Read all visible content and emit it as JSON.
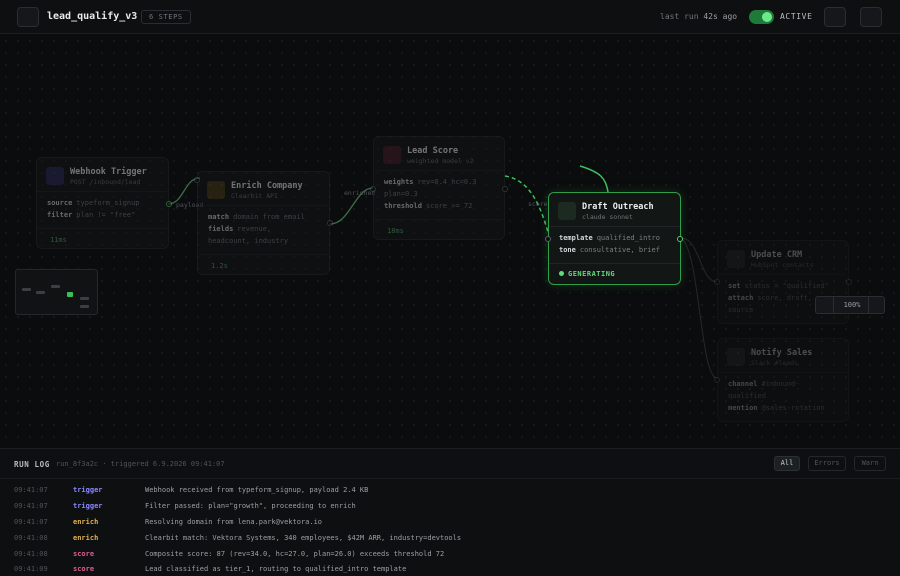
{
  "header": {
    "title": "lead_qualify_v3",
    "steps_badge": "6 STEPS",
    "last_run_prefix": "last run",
    "last_run_value": "42s ago",
    "status": "ACTIVE"
  },
  "nodes": {
    "webhook": {
      "title": "Webhook Trigger",
      "subtitle": "POST /inbound/lead",
      "fields": [
        {
          "key": "source",
          "value": "typeform_signup"
        },
        {
          "key": "filter",
          "value": "plan != \"free\""
        }
      ],
      "timing": "11ms"
    },
    "enrich": {
      "title": "Enrich Company",
      "subtitle": "Clearbit API",
      "fields": [
        {
          "key": "match",
          "value": "domain from email"
        },
        {
          "key": "fields",
          "value": "revenue,"
        },
        {
          "key": "",
          "value": "headcount, industry"
        }
      ],
      "timing": "1.2s"
    },
    "score": {
      "title": "Lead Score",
      "subtitle": "weighted model v2",
      "fields": [
        {
          "key": "weights",
          "value": "rev=0.4 hc=0.3"
        },
        {
          "key": "",
          "value": "plan=0.3"
        },
        {
          "key": "threshold",
          "value": "score >= 72"
        }
      ],
      "timing": "18ms"
    },
    "draft": {
      "title": "Draft Outreach",
      "subtitle": "claude sonnet",
      "fields": [
        {
          "key": "template",
          "value": "qualified_intro"
        },
        {
          "key": "tone",
          "value": "consultative, brief"
        }
      ],
      "status": "GENERATING"
    },
    "crm": {
      "title": "Update CRM",
      "subtitle": "HubSpot contacts",
      "fields": [
        {
          "key": "set",
          "value": "status = \"qualified\""
        },
        {
          "key": "attach",
          "value": "score, draft,"
        },
        {
          "key": "",
          "value": "source"
        }
      ]
    },
    "notify": {
      "title": "Notify Sales",
      "subtitle": "Slack #leads",
      "fields": [
        {
          "key": "channel",
          "value": "#inbound-"
        },
        {
          "key": "",
          "value": "qualified"
        },
        {
          "key": "mention",
          "value": "@sales-rotation"
        }
      ]
    }
  },
  "edge_labels": {
    "webhook_enrich": "payload",
    "enrich_score": "enriched",
    "score_draft": "score"
  },
  "zoom_level": "100%",
  "run_log": {
    "title": "RUN LOG",
    "meta": "run_8f3a2c · triggered 6.9.2026 09:41:07",
    "filters": [
      "All",
      "Errors",
      "Warn"
    ],
    "selected_filter": "All",
    "entries": [
      {
        "time": "09:41:07",
        "source": "trigger",
        "message": "Webhook received from typeform_signup, payload 2.4 KB"
      },
      {
        "time": "09:41:07",
        "source": "trigger",
        "message": "Filter passed: plan=\"growth\", proceeding to enrich"
      },
      {
        "time": "09:41:07",
        "source": "enrich",
        "message": "Resolving domain from lena.park@vektora.io"
      },
      {
        "time": "09:41:08",
        "source": "enrich",
        "message": "Clearbit match: Vektora Systems, 340 employees, $42M ARR, industry=devtools"
      },
      {
        "time": "09:41:08",
        "source": "score",
        "message": "Composite score: 87 (rev=34.0, hc=27.0, plan=26.0) exceeds threshold 72"
      },
      {
        "time": "09:41:09",
        "source": "score",
        "message": "Lead classified as tier_1, routing to qualified_intro template"
      }
    ]
  },
  "colors": {
    "accent_green": "#4fd06c",
    "trigger": "#7d7cff",
    "enrich": "#e0b34a",
    "score": "#e05c8e"
  }
}
